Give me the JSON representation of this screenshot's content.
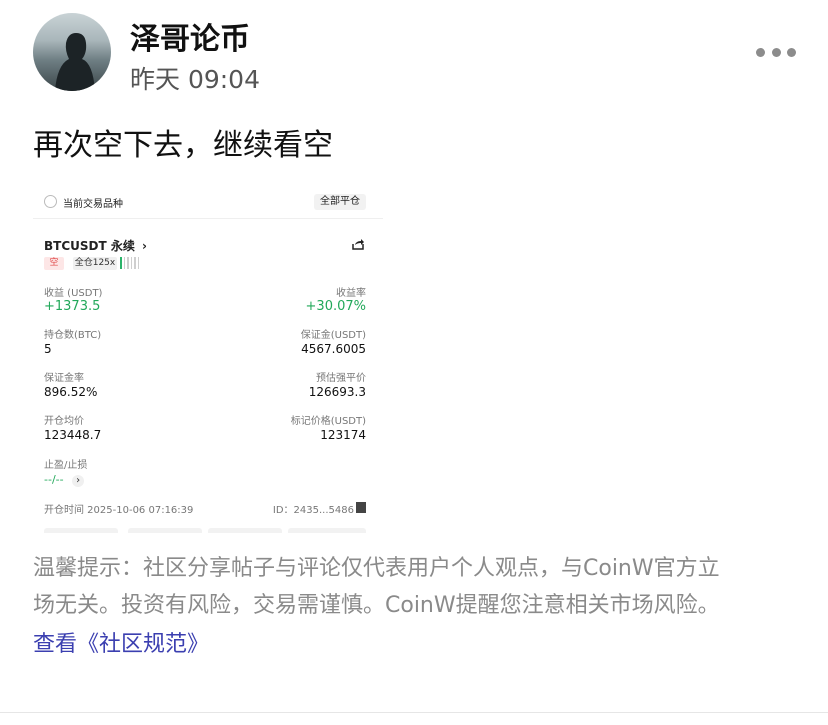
{
  "post": {
    "author": "泽哥论币",
    "time": "昨天 09:04",
    "text": "再次空下去，继续看空"
  },
  "screenshot": {
    "header": {
      "current_pair_label": "当前交易品种",
      "close_all_button": "全部平仓"
    },
    "position": {
      "symbol": "BTCUSDT 永续",
      "chevron": "›",
      "side_tag": "空",
      "leverage_tag": "全仓125x",
      "risk_level_filled": 1,
      "risk_level_total": 6
    },
    "fields": {
      "pnl_label": "收益 (USDT)",
      "pnl_value": "+1373.5",
      "roe_label": "收益率",
      "roe_value": "+30.07%",
      "size_label": "持仓数(BTC)",
      "size_value": "5",
      "margin_label": "保证金(USDT)",
      "margin_value": "4567.6005",
      "margin_ratio_label": "保证金率",
      "margin_ratio_value": "896.52%",
      "liq_label": "预估强平价",
      "liq_value": "126693.3",
      "entry_label": "开仓均价",
      "entry_value": "123448.7",
      "mark_label": "标记价格(USDT)",
      "mark_value": "123174",
      "tpsl_label": "止盈/止损",
      "tpsl_value": "--/--",
      "tpsl_chevron": "›",
      "open_time": "开仓时间 2025-10-06 07:16:39",
      "id_text": "ID：2435...5486"
    }
  },
  "notice": {
    "line1": "温馨提示：社区分享帖子与评论仅代表用户个人观点，与CoinW官方立",
    "line2": "场无关。投资有风险，交易需谨慎。CoinW提醒您注意相关市场风险。",
    "link": "查看《社区规范》"
  },
  "icons": {
    "more": "more-horizontal-icon",
    "share": "share-icon",
    "copy": "copy-icon",
    "radio": "radio-unchecked-icon"
  },
  "colors": {
    "profit_green": "#22a85a",
    "short_red": "#e04848",
    "link_blue": "#3b3fb0"
  }
}
